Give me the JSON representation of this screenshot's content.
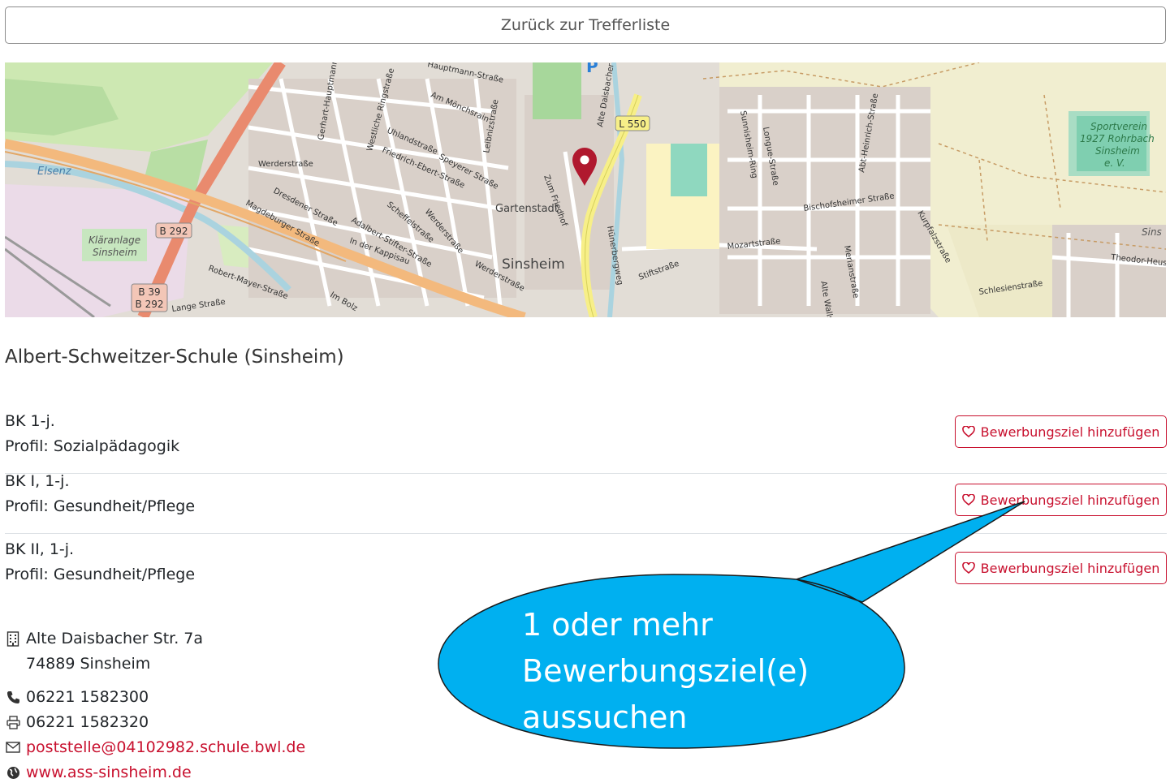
{
  "back_button": {
    "label": "Zurück zur Trefferliste"
  },
  "map": {
    "labels": {
      "l550": "L 550",
      "b292": "B 292",
      "b39": "B 39",
      "b292b": "B 292",
      "sinsheim": "Sinsheim",
      "gartenstadt": "Gartenstadt",
      "elsenz": "Elsenz",
      "klaeranlage1": "Kläranlage",
      "klaeranlage2": "Sinsheim",
      "sport1": "Sportverein",
      "sport2": "1927 Rohrbach",
      "sport3": "Sinsheim",
      "sport4": "e. V.",
      "werderstrasse": "Werderstraße",
      "dresdener": "Dresdener Straße",
      "magdeburger": "Magdeburger Straße",
      "robertmayer": "Robert-Mayer-Straße",
      "langestrasse": "Lange Straße",
      "imbolz": "Im Bolz",
      "uhland": "Uhlandstraße",
      "friedrichebert": "Friedrich-Ebert-Straße",
      "speyerer": "Speyerer Straße",
      "ammoenchsrain": "Am Mönchsrain",
      "hauptmann": "Hauptmann-Straße",
      "mozartstrasse": "Mozartstraße",
      "bischofsheimer": "Bischofsheimer Straße",
      "schlesien": "Schlesienstraße",
      "stiftstrasse": "Stiftstraße",
      "theodorheuss": "Theodor-Heuss",
      "inderkappisau": "In der Kappisau",
      "adalbert": "Adalbert-Stifter-Straße",
      "scheffel": "Scheffelstraße",
      "kurpfalz": "Kurpfalzstraße",
      "longue": "Longue-Straße",
      "sunnisheim": "Sunnisheim-Ring",
      "abtheinrich": "Abt-Heinrich-Straße",
      "huenerberg": "Hünerbergweg",
      "zumfriedhof": "Zum Friedhof",
      "altedaisbacher": "Alte Daisbacher S",
      "gerhart": "Gerhart-Hauptmann-Straße",
      "westliche": "Westliche Ringstraße",
      "leibniz": "Leibnizstraße",
      "merian": "Merianstraße",
      "altewall": "Alte Walls",
      "sins2": "Sins",
      "werderstr2": "Werderstraße",
      "werderstr3": "Werderstraße"
    }
  },
  "school": {
    "name": "Albert-Schweitzer-Schule (Sinsheim)"
  },
  "programs": [
    {
      "title": "BK 1-j.",
      "profile": "Profil: Sozialpädagogik",
      "button": "Bewerbungsziel hinzufügen"
    },
    {
      "title": "BK I, 1-j.",
      "profile": "Profil: Gesundheit/Pflege",
      "button": "Bewerbungsziel hinzufügen"
    },
    {
      "title": "BK II, 1-j.",
      "profile": "Profil: Gesundheit/Pflege",
      "button": "Bewerbungsziel hinzufügen"
    }
  ],
  "contact": {
    "street": "Alte Daisbacher Str. 7a",
    "city": "74889 Sinsheim",
    "phone": "06221 1582300",
    "fax": "06221 1582320",
    "email": "poststelle@04102982.schule.bwl.de",
    "website": "www.ass-sinsheim.de"
  },
  "callout": {
    "line1": "1 oder mehr",
    "line2": "Bewerbungsziel(e)",
    "line3": "aussuchen"
  },
  "colors": {
    "accent": "#c8102e",
    "callout_fill": "#00b0f0",
    "map_marker": "#b0182e"
  },
  "icons": [
    "building-icon",
    "phone-icon",
    "printer-icon",
    "envelope-icon",
    "globe-icon",
    "heart-icon",
    "map-pin-icon"
  ]
}
